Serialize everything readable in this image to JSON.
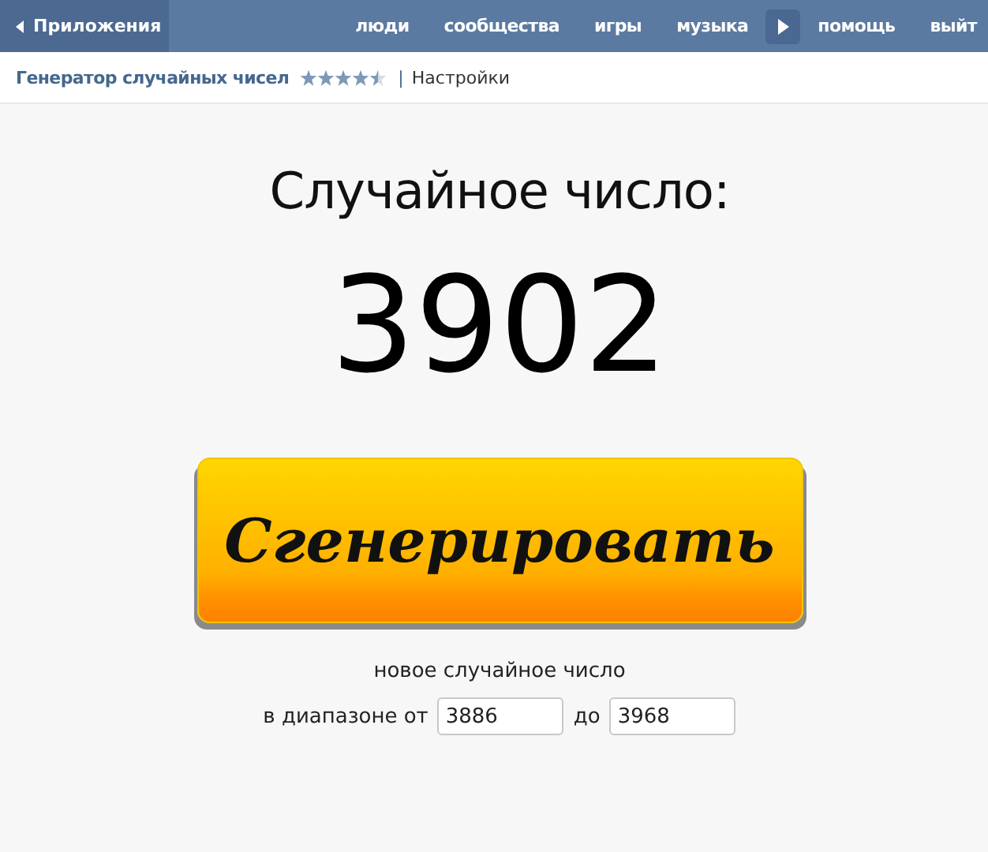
{
  "top_bar": {
    "back_label": "Приложения",
    "nav": [
      {
        "label": "люди",
        "kind": "link"
      },
      {
        "label": "сообщества",
        "kind": "link"
      },
      {
        "label": "игры",
        "kind": "link"
      },
      {
        "label": "музыка",
        "kind": "link"
      },
      {
        "kind": "arrow"
      },
      {
        "label": "помощь",
        "kind": "link"
      },
      {
        "label": "выйт",
        "kind": "link"
      }
    ]
  },
  "app_header": {
    "title": "Генератор случайных чисел",
    "stars": 4.5,
    "separator": "|",
    "settings_link": "Настройки"
  },
  "main": {
    "heading": "Случайное число:",
    "number": "3902",
    "button": "Сгенерировать",
    "caption": "новое случайное число",
    "range_label": "в диапазоне от",
    "from_value": "3886",
    "to_label": "до",
    "to_value": "3968"
  }
}
